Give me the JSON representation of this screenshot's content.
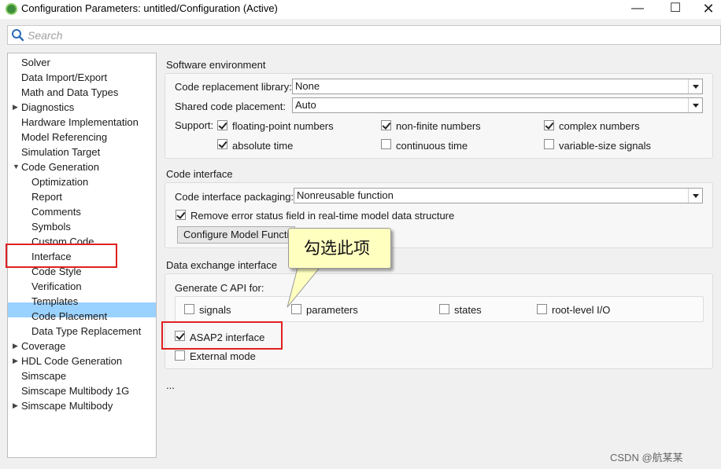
{
  "window": {
    "title": "Configuration Parameters: untitled/Configuration (Active)",
    "minimize": "—",
    "maximize": "☐",
    "close": "✕"
  },
  "search": {
    "placeholder": "Search"
  },
  "tree": {
    "items": [
      {
        "label": "Solver",
        "expandable": false
      },
      {
        "label": "Data Import/Export",
        "expandable": false
      },
      {
        "label": "Math and Data Types",
        "expandable": false
      },
      {
        "label": "Diagnostics",
        "expandable": true,
        "expanded": false
      },
      {
        "label": "Hardware Implementation",
        "expandable": false
      },
      {
        "label": "Model Referencing",
        "expandable": false
      },
      {
        "label": "Simulation Target",
        "expandable": false
      },
      {
        "label": "Code Generation",
        "expandable": true,
        "expanded": true
      },
      {
        "label": "Optimization",
        "child": true
      },
      {
        "label": "Report",
        "child": true
      },
      {
        "label": "Comments",
        "child": true
      },
      {
        "label": "Symbols",
        "child": true
      },
      {
        "label": "Custom Code",
        "child": true
      },
      {
        "label": "Interface",
        "child": true,
        "selected": true
      },
      {
        "label": "Code Style",
        "child": true
      },
      {
        "label": "Verification",
        "child": true
      },
      {
        "label": "Templates",
        "child": true
      },
      {
        "label": "Code Placement",
        "child": true
      },
      {
        "label": "Data Type Replacement",
        "child": true
      },
      {
        "label": "Coverage",
        "expandable": true,
        "expanded": false
      },
      {
        "label": "HDL Code Generation",
        "expandable": true,
        "expanded": false
      },
      {
        "label": "Simscape",
        "expandable": false
      },
      {
        "label": "Simscape Multibody 1G",
        "expandable": false
      },
      {
        "label": "Simscape Multibody",
        "expandable": true,
        "expanded": false
      }
    ]
  },
  "software_env": {
    "title": "Software environment",
    "code_replacement_library_label": "Code replacement library:",
    "code_replacement_library_value": "None",
    "shared_code_placement_label": "Shared code placement:",
    "shared_code_placement_value": "Auto",
    "support_label": "Support:",
    "floating_point": {
      "label": "floating-point numbers",
      "checked": true
    },
    "non_finite": {
      "label": "non-finite numbers",
      "checked": true
    },
    "complex": {
      "label": "complex numbers",
      "checked": true
    },
    "absolute_time": {
      "label": "absolute time",
      "checked": true
    },
    "continuous_time": {
      "label": "continuous time",
      "checked": false
    },
    "variable_size": {
      "label": "variable-size signals",
      "checked": false
    }
  },
  "code_interface": {
    "title": "Code interface",
    "packaging_label": "Code interface packaging:",
    "packaging_value": "Nonreusable function",
    "remove_error_status": {
      "label": "Remove error status field in real-time model data structure",
      "checked": true
    },
    "configure_button": "Configure Model Functions"
  },
  "data_exchange": {
    "title": "Data exchange interface",
    "generate_c_api_label": "Generate C API for:",
    "signals": {
      "label": "signals",
      "checked": false
    },
    "parameters": {
      "label": "parameters",
      "checked": false
    },
    "states": {
      "label": "states",
      "checked": false
    },
    "root_level_io": {
      "label": "root-level I/O",
      "checked": false
    },
    "asap2": {
      "label": "ASAP2 interface",
      "checked": true
    },
    "external_mode": {
      "label": "External mode",
      "checked": false
    }
  },
  "ellipsis": "...",
  "annotation": {
    "callout_text": "勾选此项",
    "highlight_color": "#e02020",
    "callout_bg": "#ffffc0"
  },
  "selection_color": "#99d1ff",
  "watermark": "CSDN @航某某"
}
